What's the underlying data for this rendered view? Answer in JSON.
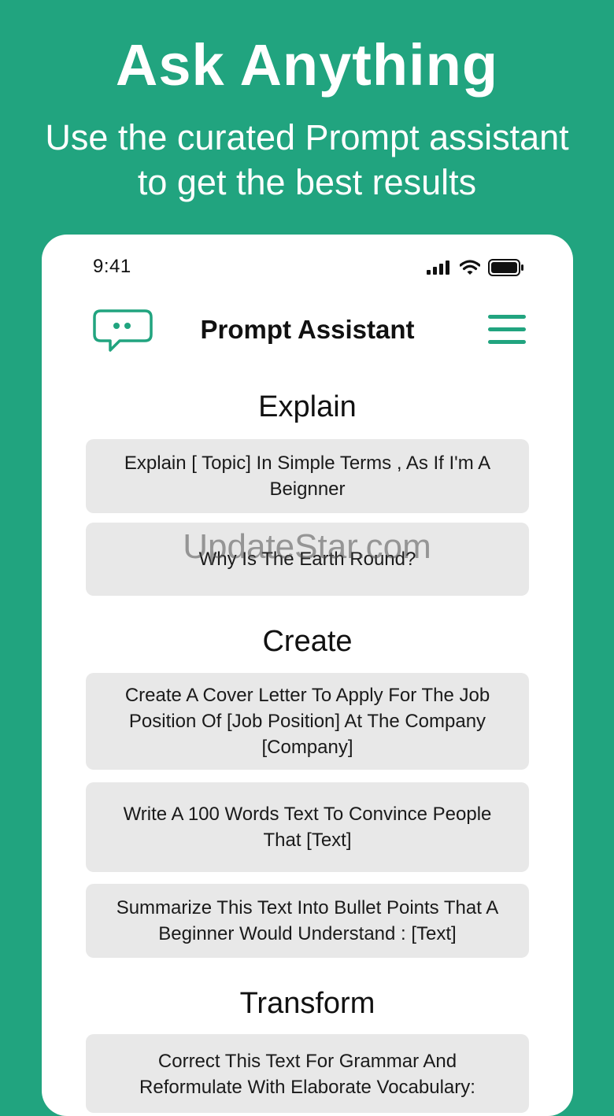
{
  "hero": {
    "title": "Ask Anything",
    "subtitle_line1": "Use the curated Prompt assistant",
    "subtitle_line2": "to get the best results"
  },
  "status_bar": {
    "time": "9:41",
    "icons": [
      "signal-icon",
      "wifi-icon",
      "battery-icon"
    ]
  },
  "app_bar": {
    "title": "Prompt Assistant",
    "left_icon": "chat-bubble-icon",
    "right_icon": "menu-icon"
  },
  "sections": [
    {
      "title": "Explain",
      "prompts": [
        "Explain [ Topic] In Simple Terms , As If I'm A Beignner",
        "Why Is The Earth Round?"
      ]
    },
    {
      "title": "Create",
      "prompts": [
        "Create A Cover Letter To Apply For The Job Position Of [Job Position] At The Company [Company]",
        "Write A 100 Words Text To Convince People That [Text]",
        "Summarize This Text Into Bullet Points That A Beginner Would Understand : [Text]"
      ]
    },
    {
      "title": "Transform",
      "prompts": [
        "Correct This Text For Grammar And Reformulate With Elaborate Vocabulary:"
      ]
    }
  ],
  "watermark": "UpdateStar.com",
  "colors": {
    "background": "#21a47f",
    "accent": "#21a47f",
    "card": "#e8e8e8"
  }
}
